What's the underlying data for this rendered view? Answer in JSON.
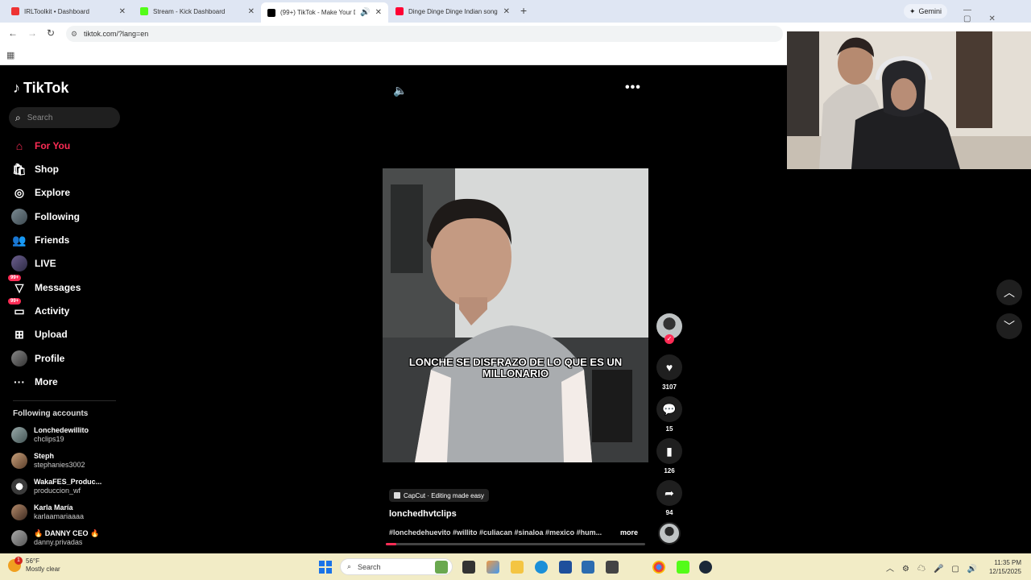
{
  "browser": {
    "tabs": [
      {
        "title": "IRLToolkit • Dashboard",
        "favicon_color": "#e33"
      },
      {
        "title": "Stream - Kick Dashboard",
        "favicon_color": "#53fc18"
      },
      {
        "title": "(99+) TikTok - Make Your Day",
        "favicon_color": "#000"
      },
      {
        "title": "Dinge Dinge Dinge Indian song",
        "favicon_color": "#ff0033"
      }
    ],
    "active_tab_index": 2,
    "new_tab_symbol": "+",
    "gemini_label": "Gemini",
    "url": "tiktok.com/?lang=en"
  },
  "tiktok": {
    "logo_text": "TikTok",
    "search_placeholder": "Search",
    "nav": [
      {
        "label": "For You",
        "icon": "home-icon",
        "active": true
      },
      {
        "label": "Shop",
        "icon": "shop-icon"
      },
      {
        "label": "Explore",
        "icon": "compass-icon"
      },
      {
        "label": "Following",
        "icon": "avatar-icon"
      },
      {
        "label": "Friends",
        "icon": "friends-icon"
      },
      {
        "label": "LIVE",
        "icon": "live-avatar-icon"
      },
      {
        "label": "Messages",
        "icon": "messages-icon",
        "badge": "99+"
      },
      {
        "label": "Activity",
        "icon": "activity-icon",
        "badge": "99+"
      },
      {
        "label": "Upload",
        "icon": "upload-icon"
      },
      {
        "label": "Profile",
        "icon": "profile-avatar-icon"
      },
      {
        "label": "More",
        "icon": "more-dots-icon"
      }
    ],
    "following_title": "Following accounts",
    "following_accounts": [
      {
        "name": "Lonchedewillito",
        "handle": "chclips19"
      },
      {
        "name": "Steph",
        "handle": "stephanies3002"
      },
      {
        "name": "WakaFES_Produc...",
        "handle": "produccion_wf"
      },
      {
        "name": "Karla María",
        "handle": "karlaamariaaaa"
      },
      {
        "name": "🔥 DANNY CEO 🔥",
        "handle": "danny.privadas"
      }
    ],
    "video": {
      "caption": "LONCHE SE DISFRAZO DE LO QUE ES UN MILLONARIO",
      "capcut_label": "CapCut · Editing made easy",
      "author": "lonchedhvtclips",
      "hashtags": "#lonchedehuevito #willito #culiacan #sinaloa #mexico #hum...",
      "more_label": "more",
      "progress_percent": 4
    },
    "actions": {
      "likes": "3107",
      "comments": "15",
      "saves": "126",
      "shares": "94"
    }
  },
  "taskbar": {
    "weather_temp": "56°F",
    "weather_desc": "Mostly clear",
    "weather_badge": "1",
    "search_label": "Search",
    "time": "11:35 PM",
    "date": "12/15/2025"
  }
}
